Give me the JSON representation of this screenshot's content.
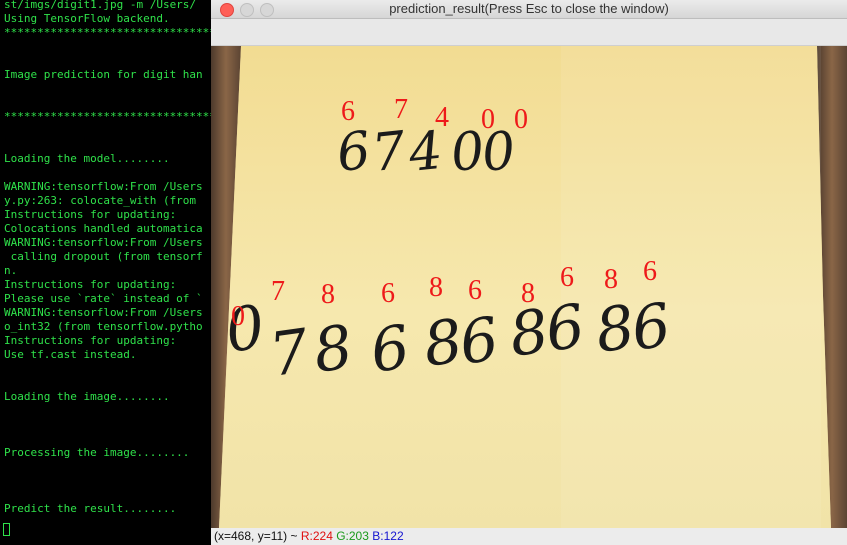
{
  "terminal": {
    "lines": [
      "st/imgs/digit1.jpg -m /Users/",
      "Using TensorFlow backend.",
      "****************************************",
      "",
      "",
      "Image prediction for digit han",
      "",
      "",
      "****************************************",
      "",
      "",
      "Loading the model........",
      "",
      "WARNING:tensorflow:From /Users",
      "y.py:263: colocate_with (from",
      "Instructions for updating:",
      "Colocations handled automatica",
      "WARNING:tensorflow:From /Users",
      " calling dropout (from tensorf",
      "n.",
      "Instructions for updating:",
      "Please use `rate` instead of `",
      "WARNING:tensorflow:From /Users",
      "o_int32 (from tensorflow.pytho",
      "Instructions for updating:",
      "Use tf.cast instead.",
      "",
      "",
      "Loading the image........",
      "",
      "",
      "",
      "Processing the image........",
      "",
      "",
      "",
      "Predict the result........"
    ]
  },
  "window": {
    "title": "prediction_result(Press Esc to close the window)"
  },
  "photo": {
    "row1_handwritten": [
      "6",
      "7",
      "4",
      "0",
      "0"
    ],
    "row1_predictions": [
      "6",
      "7",
      "4",
      "0",
      "0"
    ],
    "row2_handwritten": [
      "0",
      "7",
      "8",
      "6",
      "8",
      "6",
      "8",
      "6",
      "8",
      "6"
    ],
    "row2_predictions": [
      "0",
      "7",
      "8",
      "6",
      "8",
      "6",
      "8",
      "6",
      "8",
      "6"
    ]
  },
  "status": {
    "coords": "(x=468, y=11) ~",
    "r": "R:224",
    "g": "G:203",
    "b": "B:122"
  },
  "colors": {
    "terminal_text": "#2fe14a",
    "prediction_text": "#ee1a1a",
    "note_paper": "#f3e29e"
  }
}
